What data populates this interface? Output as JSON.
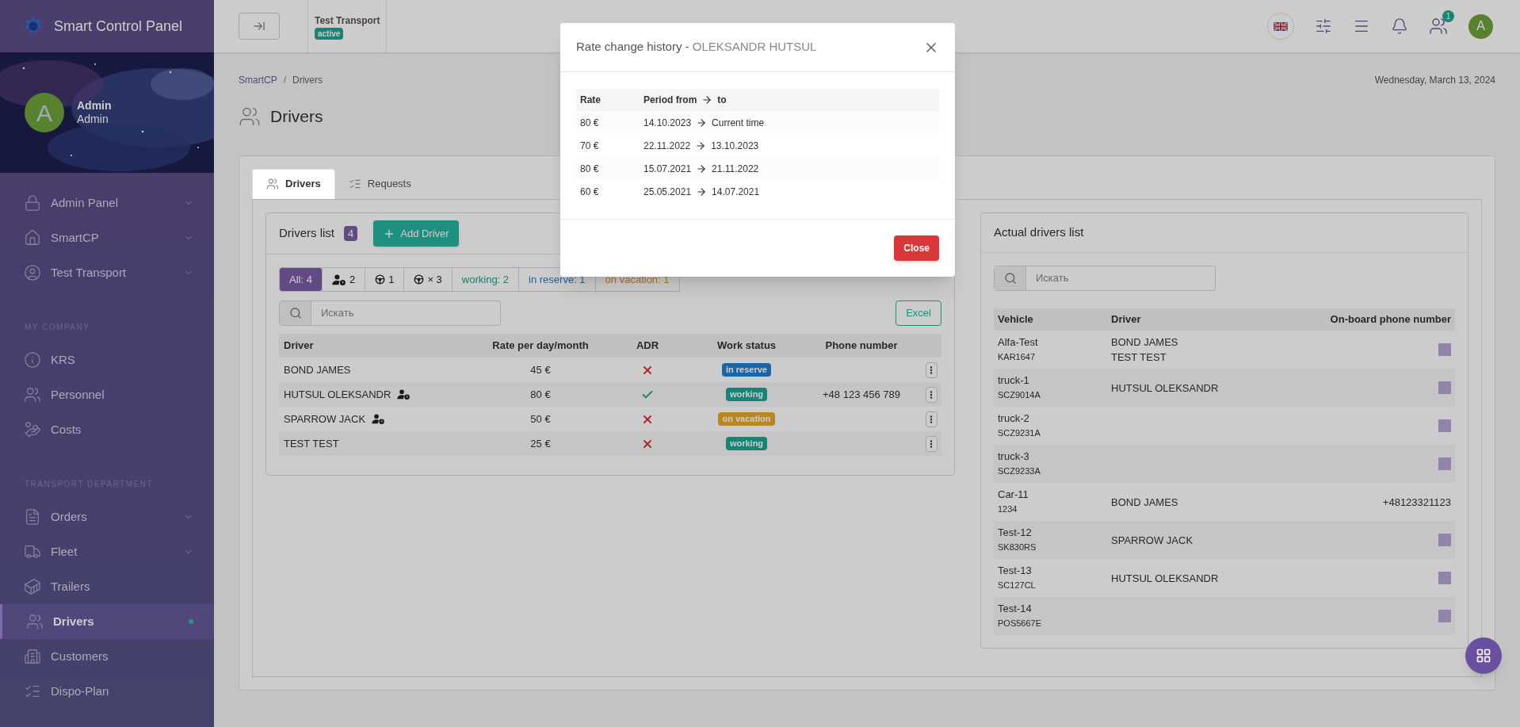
{
  "sidebar": {
    "brand": "Smart Control Panel",
    "user": {
      "initial": "A",
      "name": "Admin",
      "role": "Admin"
    },
    "sections": [
      {
        "items": [
          {
            "label": "Admin Panel",
            "expandable": true,
            "selected": false
          },
          {
            "label": "SmartCP",
            "expandable": true,
            "selected": false
          },
          {
            "label": "Test Transport",
            "expandable": true,
            "selected": false
          }
        ]
      },
      {
        "heading": "MY COMPANY",
        "items": [
          {
            "label": "KRS",
            "expandable": false,
            "selected": false
          },
          {
            "label": "Personnel",
            "expandable": false,
            "selected": false
          },
          {
            "label": "Costs",
            "expandable": false,
            "selected": false
          }
        ]
      },
      {
        "heading": "TRANSPORT DEPARTMENT",
        "items": [
          {
            "label": "Orders",
            "expandable": true,
            "selected": false
          },
          {
            "label": "Fleet",
            "expandable": true,
            "selected": false
          },
          {
            "label": "Trailers",
            "expandable": false,
            "selected": false
          },
          {
            "label": "Drivers",
            "expandable": false,
            "selected": true
          },
          {
            "label": "Customers",
            "expandable": false,
            "selected": false
          },
          {
            "label": "Dispo-Plan",
            "expandable": false,
            "selected": false
          }
        ]
      }
    ]
  },
  "topbar": {
    "company": "Test Transport",
    "status": "active",
    "contacts_badge": "1",
    "avatar": "A"
  },
  "breadcrumbs": {
    "items": [
      "SmartCP",
      "Drivers"
    ],
    "separator": "/"
  },
  "date": "Wednesday, March 13, 2024",
  "page_title": "Drivers",
  "tabs": [
    {
      "label": "Drivers",
      "selected": true
    },
    {
      "label": "Requests",
      "selected": false
    }
  ],
  "drivers_list": {
    "title": "Drivers list",
    "count": "4",
    "add_button": "Add Driver",
    "filters": [
      {
        "kind": "plain",
        "label": "All: 4",
        "selected": true
      },
      {
        "kind": "person-clock",
        "label": "2",
        "selected": false
      },
      {
        "kind": "steering",
        "label": "1",
        "selected": false
      },
      {
        "kind": "steering",
        "label": "× 3",
        "selected": false
      },
      {
        "kind": "working",
        "label": "working: 2",
        "selected": false
      },
      {
        "kind": "reserve",
        "label": "in reserve: 1",
        "selected": false
      },
      {
        "kind": "vacation",
        "label": "on vacation: 1",
        "selected": false
      }
    ],
    "search_placeholder": "Искать",
    "excel_button": "Excel",
    "columns": [
      "Driver",
      "Rate per day/month",
      "ADR",
      "Work status",
      "Phone number"
    ],
    "rows": [
      {
        "driver": "BOND JAMES",
        "clock_icon": false,
        "rate": "45 €",
        "adr": false,
        "status": {
          "kind": "reserve",
          "label": "in reserve"
        }
      },
      {
        "driver": "HUTSUL OLEKSANDR",
        "clock_icon": true,
        "rate": "80 €",
        "adr": true,
        "status": {
          "kind": "working",
          "label": "working"
        },
        "phone": "+48 123 456 789"
      },
      {
        "driver": "SPARROW JACK",
        "clock_icon": true,
        "rate": "50 €",
        "adr": false,
        "status": {
          "kind": "vacation",
          "label": "on vacation"
        }
      },
      {
        "driver": "TEST TEST",
        "clock_icon": false,
        "rate": "25 €",
        "adr": false,
        "status": {
          "kind": "working",
          "label": "working"
        }
      }
    ]
  },
  "actual_drivers": {
    "title": "Actual drivers list",
    "search_placeholder": "Искать",
    "columns": [
      "Vehicle",
      "Driver",
      "On-board phone number"
    ],
    "rows": [
      {
        "vehicle": "Alfa-Test",
        "plate": "KAR1647",
        "drivers": [
          "BOND JAMES",
          "TEST TEST"
        ]
      },
      {
        "vehicle": "truck-1",
        "plate": "SCZ9014A",
        "drivers": [
          "HUTSUL OLEKSANDR"
        ]
      },
      {
        "vehicle": "truck-2",
        "plate": "SCZ9231A",
        "drivers": []
      },
      {
        "vehicle": "truck-3",
        "plate": "SCZ9233A",
        "drivers": []
      },
      {
        "vehicle": "Car-11",
        "plate": "1234",
        "drivers": [
          "BOND JAMES"
        ],
        "phone": "+48123321123"
      },
      {
        "vehicle": "Test-12",
        "plate": "SK830RS",
        "drivers": [
          "SPARROW JACK"
        ]
      },
      {
        "vehicle": "Test-13",
        "plate": "SC127CL",
        "drivers": [
          "HUTSUL OLEKSANDR"
        ]
      },
      {
        "vehicle": "Test-14",
        "plate": "POS5667E",
        "drivers": []
      }
    ]
  },
  "modal": {
    "title": "Rate change history - ",
    "subject": "OLEKSANDR HUTSUL",
    "columns": [
      "Rate",
      "Period from",
      "to"
    ],
    "rows": [
      {
        "rate": "80 €",
        "from": "14.10.2023",
        "to": "Current time"
      },
      {
        "rate": "70 €",
        "from": "22.11.2022",
        "to": "13.10.2023"
      },
      {
        "rate": "80 €",
        "from": "15.07.2021",
        "to": "21.11.2022"
      },
      {
        "rate": "60 €",
        "from": "25.05.2021",
        "to": "14.07.2021"
      }
    ],
    "close_button": "Close"
  }
}
